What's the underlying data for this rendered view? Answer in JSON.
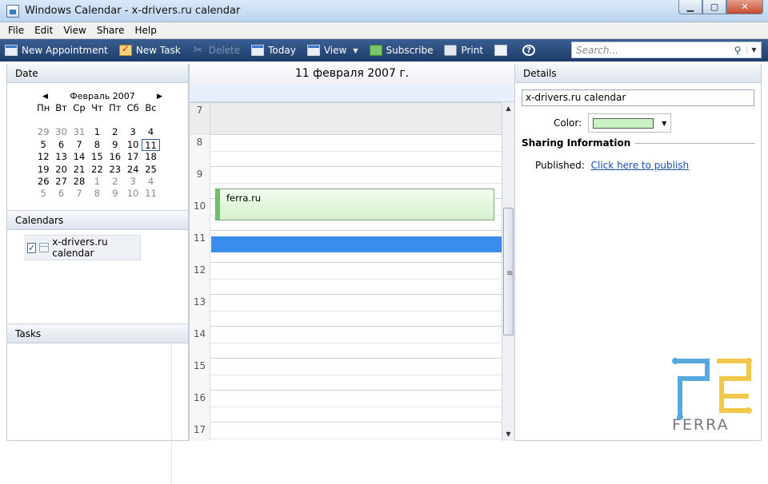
{
  "window": {
    "title": "Windows Calendar - x-drivers.ru calendar",
    "minimize": "▁",
    "maximize": "▢",
    "close": "✕"
  },
  "menu": [
    "File",
    "Edit",
    "View",
    "Share",
    "Help"
  ],
  "toolbar": {
    "new_appointment": "New Appointment",
    "new_task": "New Task",
    "delete": "Delete",
    "today": "Today",
    "view": "View",
    "subscribe": "Subscribe",
    "print": "Print",
    "help": "?",
    "search_placeholder": "Search..."
  },
  "date_pane": {
    "header": "Date",
    "month": "Февраль 2007",
    "prev": "◀",
    "next": "▶",
    "weekdays": [
      "Пн",
      "Вт",
      "Ср",
      "Чт",
      "Пт",
      "Сб",
      "Вс"
    ],
    "weeks": [
      [
        [
          "29",
          1
        ],
        [
          "30",
          1
        ],
        [
          "31",
          1
        ],
        [
          "1",
          0
        ],
        [
          "2",
          0
        ],
        [
          "3",
          0
        ],
        [
          "4",
          0
        ]
      ],
      [
        [
          "5",
          0
        ],
        [
          "6",
          0
        ],
        [
          "7",
          0
        ],
        [
          "8",
          0
        ],
        [
          "9",
          0
        ],
        [
          "10",
          0
        ],
        [
          "11",
          2
        ]
      ],
      [
        [
          "12",
          0
        ],
        [
          "13",
          0
        ],
        [
          "14",
          0
        ],
        [
          "15",
          0
        ],
        [
          "16",
          0
        ],
        [
          "17",
          0
        ],
        [
          "18",
          0
        ]
      ],
      [
        [
          "19",
          0
        ],
        [
          "20",
          0
        ],
        [
          "21",
          0
        ],
        [
          "22",
          0
        ],
        [
          "23",
          0
        ],
        [
          "24",
          0
        ],
        [
          "25",
          0
        ]
      ],
      [
        [
          "26",
          0
        ],
        [
          "27",
          0
        ],
        [
          "28",
          0
        ],
        [
          "1",
          1
        ],
        [
          "2",
          1
        ],
        [
          "3",
          1
        ],
        [
          "4",
          1
        ]
      ],
      [
        [
          "5",
          1
        ],
        [
          "6",
          1
        ],
        [
          "7",
          1
        ],
        [
          "8",
          1
        ],
        [
          "9",
          1
        ],
        [
          "10",
          1
        ],
        [
          "11",
          1
        ]
      ]
    ]
  },
  "calendars_pane": {
    "header": "Calendars",
    "items": [
      {
        "name": "x-drivers.ru calendar",
        "checked": "✓"
      }
    ]
  },
  "tasks_pane": {
    "header": "Tasks"
  },
  "day_view": {
    "date_header": "11 февраля 2007 г.",
    "hours": [
      "7",
      "8",
      "9",
      "10",
      "11",
      "12",
      "13",
      "14",
      "15",
      "16",
      "17"
    ],
    "appointment": {
      "title": "ferra.ru"
    },
    "scroll_up": "▲",
    "scroll_down": "▼",
    "scroll_grip": "≡"
  },
  "details": {
    "header": "Details",
    "calendar_name": "x-drivers.ru calendar",
    "color_label": "Color:",
    "color_value": "#c8f4c4",
    "sharing_header": "Sharing Information",
    "published_label": "Published:",
    "publish_link": "Click here to publish"
  },
  "watermark": {
    "text": "FERRA"
  }
}
